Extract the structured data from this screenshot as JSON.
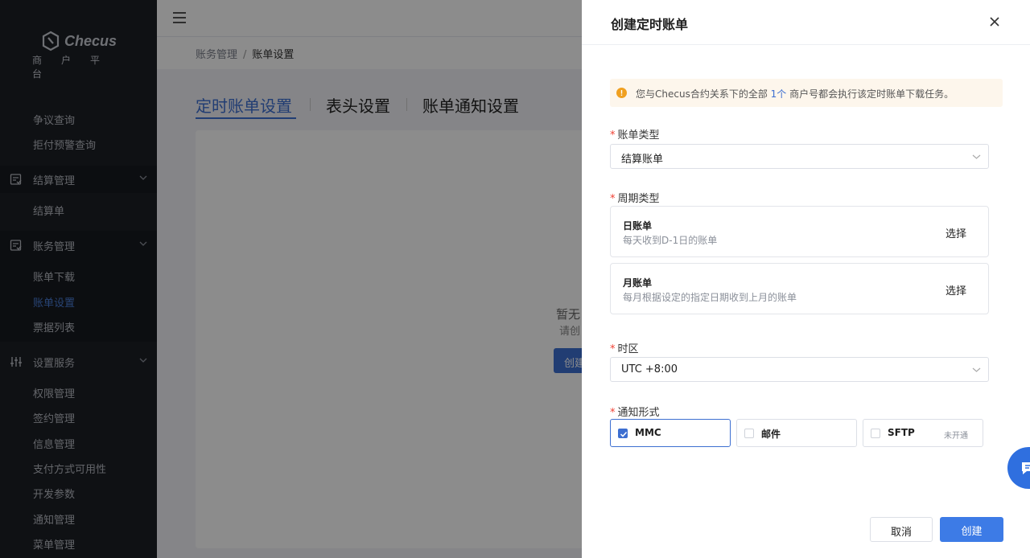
{
  "brand": {
    "name": "Checus",
    "subtitle": "商户平台"
  },
  "sidebar": {
    "top_items": [
      "争议查询",
      "拒付预警查询"
    ],
    "groups": [
      {
        "label": "结算管理",
        "icon": "checklist-icon",
        "items": [
          "结算单"
        ]
      },
      {
        "label": "账务管理",
        "icon": "checklist-icon",
        "items": [
          "账单下载",
          "账单设置",
          "票据列表"
        ],
        "active_item": "账单设置"
      },
      {
        "label": "设置服务",
        "icon": "sliders-icon",
        "items": [
          "权限管理",
          "签约管理",
          "信息管理",
          "支付方式可用性",
          "开发参数",
          "通知管理",
          "菜单管理"
        ]
      }
    ]
  },
  "breadcrumb": {
    "parent": "账务管理",
    "separator": "/",
    "current": "账单设置"
  },
  "tabs": [
    "定时账单设置",
    "表头设置",
    "账单通知设置"
  ],
  "empty_state": {
    "title": "暂无",
    "subtitle": "请创",
    "button": "创建"
  },
  "drawer": {
    "title": "创建定时账单",
    "alert": {
      "prefix": "您与Checus合约关系下的全部 ",
      "highlight": "1个",
      "suffix": " 商户号都会执行该定时账单下载任务。"
    },
    "bill_type": {
      "label": "账单类型",
      "value": "结算账单"
    },
    "period": {
      "label": "周期类型",
      "options": [
        {
          "title": "日账单",
          "desc": "每天收到D-1日的账单",
          "action": "选择"
        },
        {
          "title": "月账单",
          "desc": "每月根据设定的指定日期收到上月的账单",
          "action": "选择"
        }
      ]
    },
    "timezone": {
      "label": "时区",
      "value": "UTC +8:00"
    },
    "notify": {
      "label": "通知形式",
      "options": [
        {
          "label": "MMC",
          "checked": true
        },
        {
          "label": "邮件",
          "checked": false
        },
        {
          "label": "SFTP",
          "checked": false,
          "tag": "未开通"
        }
      ]
    },
    "cancel": "取消",
    "submit": "创建"
  },
  "colors": {
    "primary": "#3d7be6",
    "sidebar_bg": "#1c1f26",
    "required": "#f04134",
    "warning": "#f0a020"
  }
}
